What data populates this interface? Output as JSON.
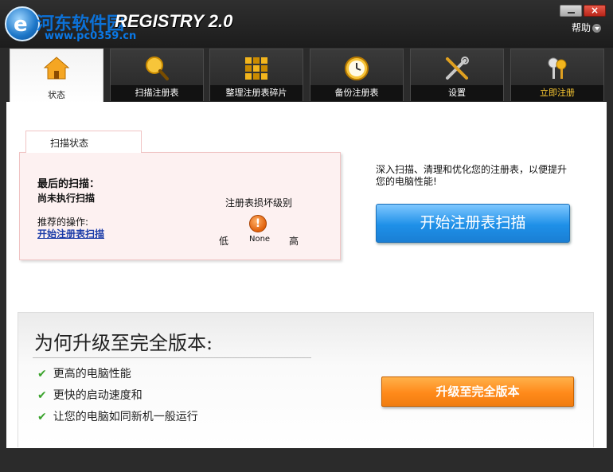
{
  "window": {
    "app_title": "REGISTRY 2.0",
    "watermark_text": "河东软件园",
    "watermark_url": "www.pc0359.cn",
    "close_glyph": "×",
    "help_label": "帮助"
  },
  "tabs": [
    {
      "label": "状态",
      "icon": "home-icon"
    },
    {
      "label": "扫描注册表",
      "icon": "magnifier-icon"
    },
    {
      "label": "整理注册表碎片",
      "icon": "defrag-blocks-icon"
    },
    {
      "label": "备份注册表",
      "icon": "clock-icon"
    },
    {
      "label": "设置",
      "icon": "tools-icon"
    },
    {
      "label": "立即注册",
      "icon": "keys-icon"
    }
  ],
  "status_panel": {
    "tab_label": "扫描状态",
    "last_scan_title": "最后的扫描：",
    "last_scan_value": "尚未执行扫描",
    "recommend_label": "推荐的操作:",
    "recommend_link": "开始注册表扫描",
    "damage_title": "注册表损坏级别",
    "level_low": "低",
    "level_high": "高",
    "level_value": "None",
    "level_icon_glyph": "!"
  },
  "promo": {
    "text": "深入扫描、清理和优化您的注册表，以便提升您的电脑性能!",
    "scan_button": "开始注册表扫描"
  },
  "upgrade": {
    "title": "为何升级至完全版本:",
    "benefits": [
      "更高的电脑性能",
      "更快的启动速度和",
      "让您的电脑如同新机一般运行"
    ],
    "check_glyph": "✔",
    "button": "升级至完全版本"
  },
  "colors": {
    "accent_blue": "#1e90e8",
    "accent_orange": "#ff8a1a",
    "register_tab": "#ffcc33"
  }
}
